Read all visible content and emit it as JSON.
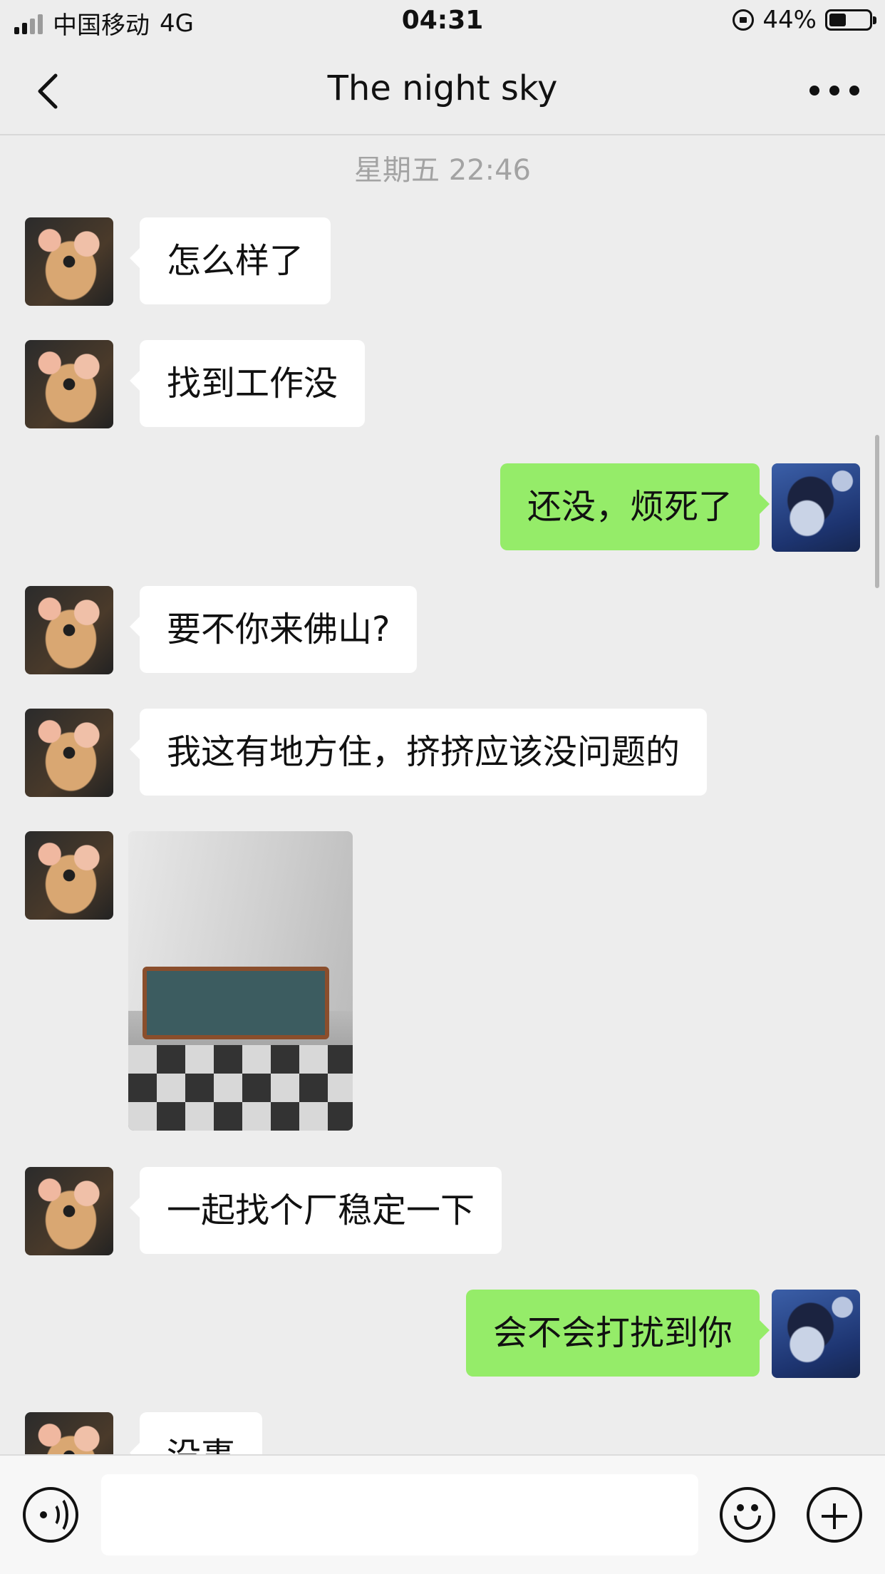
{
  "status_bar": {
    "carrier": "中国移动",
    "network": "4G",
    "time": "04:31",
    "battery_percent": "44%",
    "signal_bars_active": 2
  },
  "header": {
    "title": "The night sky",
    "back_icon": "chevron-left-icon",
    "more_icon": "more-dots-icon"
  },
  "chat": {
    "timestamp": "星期五 22:46",
    "messages": [
      {
        "side": "left",
        "type": "text",
        "text": "怎么样了"
      },
      {
        "side": "left",
        "type": "text",
        "text": "找到工作没"
      },
      {
        "side": "right",
        "type": "text",
        "text": "还没，烦死了"
      },
      {
        "side": "left",
        "type": "text",
        "text": "要不你来佛山?"
      },
      {
        "side": "left",
        "type": "text",
        "text": "我这有地方住，挤挤应该没问题的"
      },
      {
        "side": "left",
        "type": "image",
        "text": ""
      },
      {
        "side": "left",
        "type": "text",
        "text": "一起找个厂稳定一下"
      },
      {
        "side": "right",
        "type": "text",
        "text": "会不会打扰到你"
      },
      {
        "side": "left",
        "type": "text",
        "text": "没事"
      }
    ]
  },
  "input_bar": {
    "voice_icon": "voice-icon",
    "emoji_icon": "emoji-icon",
    "add_icon": "plus-icon",
    "input_value": ""
  },
  "colors": {
    "background": "#ededed",
    "incoming_bubble": "#ffffff",
    "outgoing_bubble": "#95ec69"
  }
}
